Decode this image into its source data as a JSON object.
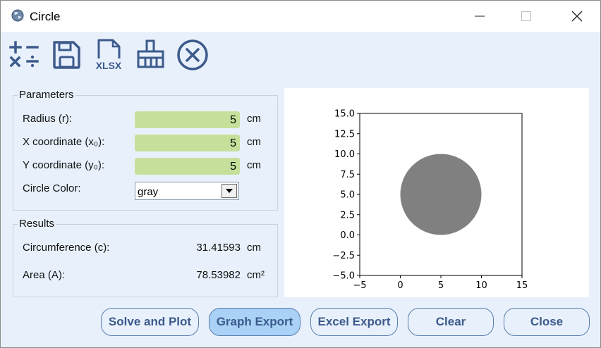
{
  "window": {
    "title": "Circle"
  },
  "colors": {
    "accent": "#3d5a8c",
    "field_bg": "#c6e09b",
    "active_button": "#a9d2f6",
    "circle": "#808080"
  },
  "toolbar": {
    "icons": [
      "calculator-icon",
      "save-icon",
      "xlsx-icon",
      "broom-icon",
      "close-circle-icon"
    ],
    "xlsx_label": "XLSX"
  },
  "parameters": {
    "title": "Parameters",
    "radius_label": "Radius (r):",
    "radius_value": "5",
    "radius_unit": "cm",
    "x_label": "X coordinate (x₀):",
    "x_value": "5",
    "x_unit": "cm",
    "y_label": "Y coordinate (y₀):",
    "y_value": "5",
    "y_unit": "cm",
    "color_label": "Circle Color:",
    "color_value": "gray"
  },
  "results": {
    "title": "Results",
    "circumference_label": "Circumference (c):",
    "circumference_value": "31.41593",
    "circumference_unit": "cm",
    "area_label": "Area (A):",
    "area_value": "78.53982",
    "area_unit": "cm²"
  },
  "buttons": {
    "solve": "Solve and Plot",
    "graph_export": "Graph Export",
    "excel_export": "Excel Export",
    "clear": "Clear",
    "close": "Close"
  },
  "chart_data": {
    "type": "scatter",
    "title": "",
    "xlabel": "",
    "ylabel": "",
    "xlim": [
      -5,
      15
    ],
    "ylim": [
      -5,
      15
    ],
    "x_ticks": [
      "−5",
      "0",
      "5",
      "10",
      "15"
    ],
    "y_ticks": [
      "15.0",
      "12.5",
      "10.0",
      "7.5",
      "5.0",
      "2.5",
      "0.0",
      "−2.5",
      "−5.0"
    ],
    "circle": {
      "cx": 5,
      "cy": 5,
      "r": 5,
      "color": "gray"
    },
    "grid": false
  }
}
